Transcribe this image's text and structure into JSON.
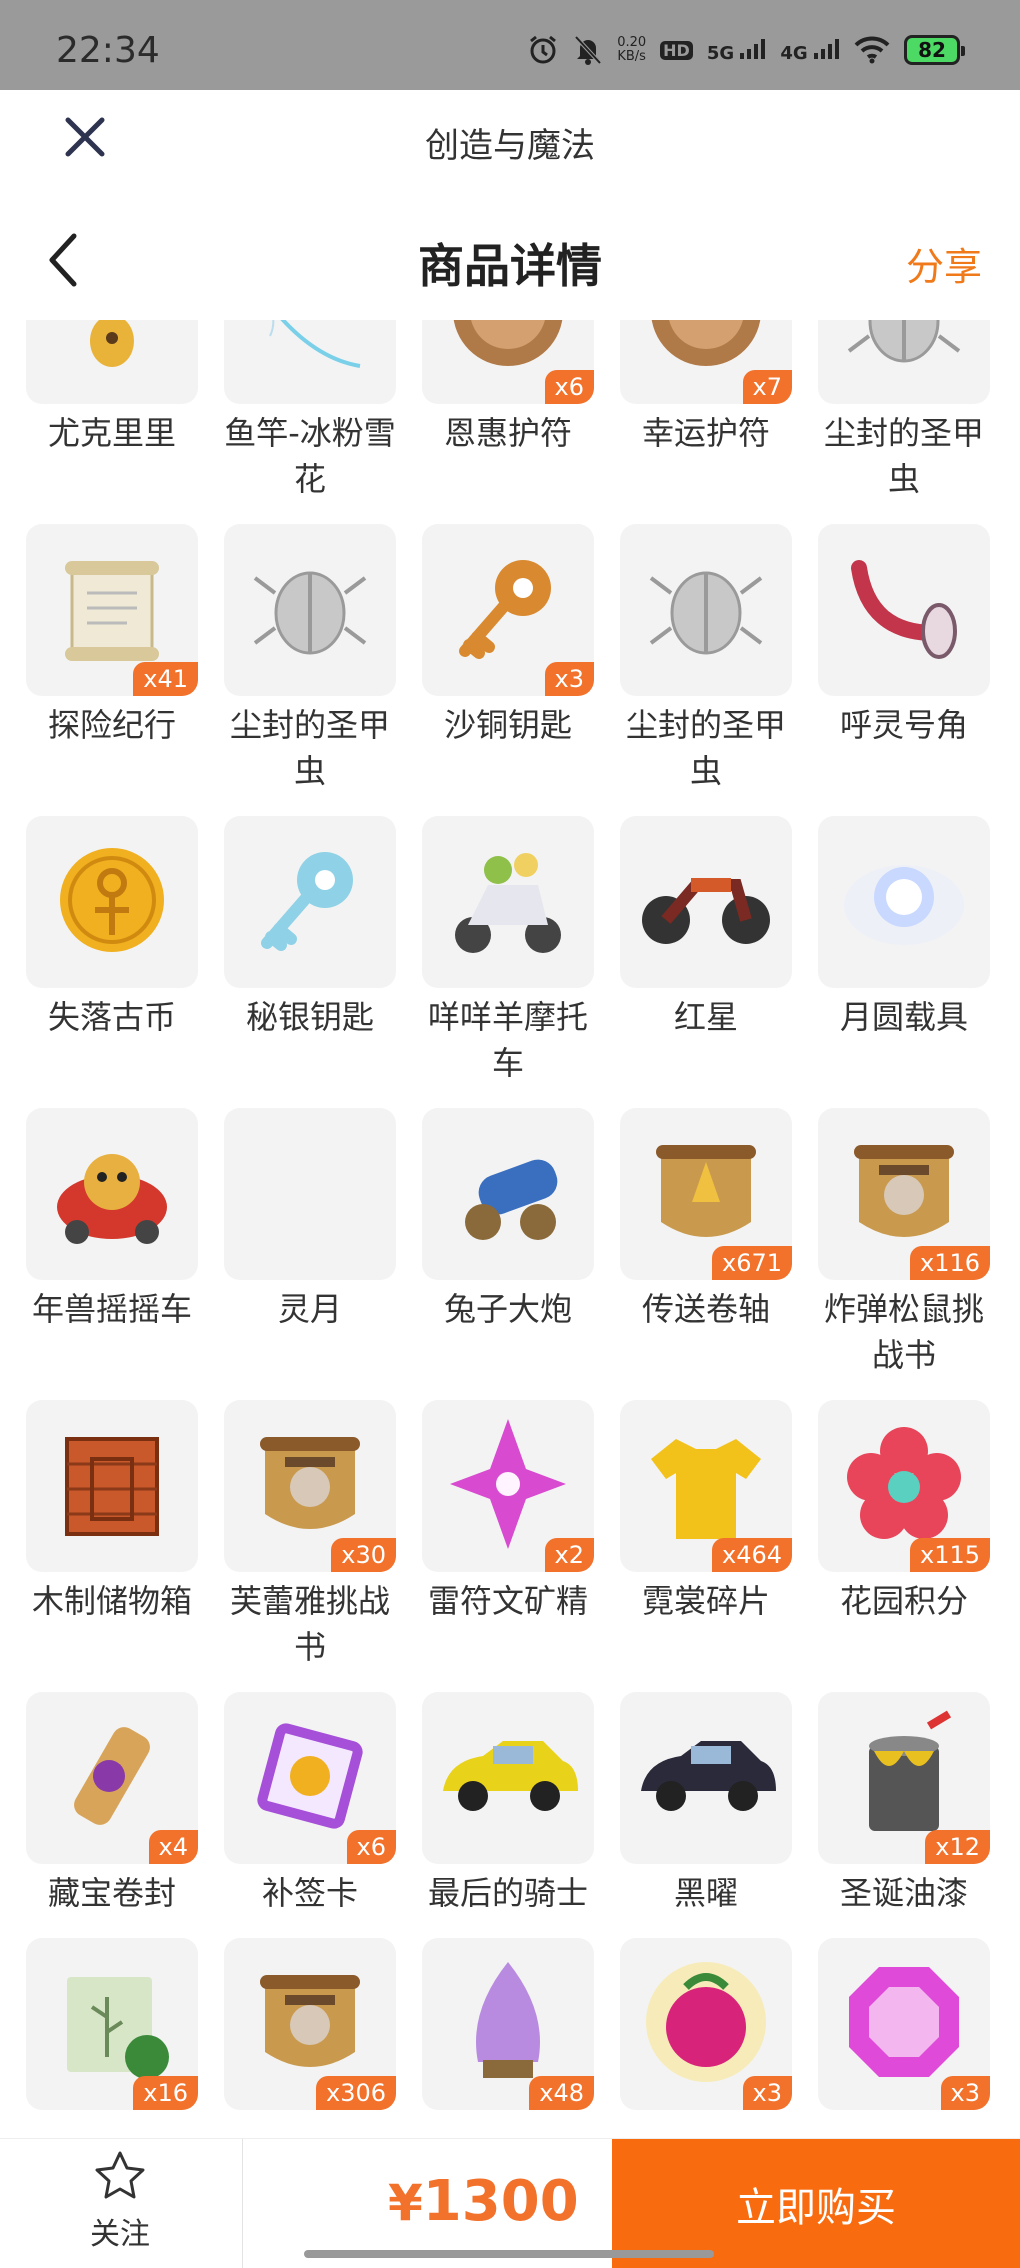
{
  "status_bar": {
    "time": "22:34",
    "speed_value": "0.20",
    "speed_unit": "KB/s",
    "hd_label": "HD",
    "net1": "5G",
    "net2": "4G",
    "battery": "82"
  },
  "app_bar": {
    "title": "创造与魔法"
  },
  "nav": {
    "title": "商品详情",
    "share": "分享"
  },
  "items": [
    {
      "name": "尤克里里",
      "qty": "",
      "icon": "ukulele",
      "color": "#e9b33a"
    },
    {
      "name": "鱼竿-冰粉雪花",
      "qty": "",
      "icon": "fishing-rod",
      "color": "#7ad0e8"
    },
    {
      "name": "恩惠护符",
      "qty": "x6",
      "icon": "amulet",
      "color": "#b07a48"
    },
    {
      "name": "幸运护符",
      "qty": "x7",
      "icon": "amulet",
      "color": "#b07a48"
    },
    {
      "name": "尘封的圣甲虫",
      "qty": "",
      "icon": "beetle",
      "color": "#9a9a9a"
    },
    {
      "name": "探险纪行",
      "qty": "x41",
      "icon": "scroll",
      "color": "#efe9d6"
    },
    {
      "name": "尘封的圣甲虫",
      "qty": "",
      "icon": "beetle",
      "color": "#9a9a9a"
    },
    {
      "name": "沙铜钥匙",
      "qty": "x3",
      "icon": "key",
      "color": "#d98a30"
    },
    {
      "name": "尘封的圣甲虫",
      "qty": "",
      "icon": "beetle",
      "color": "#9a9a9a"
    },
    {
      "name": "呼灵号角",
      "qty": "",
      "icon": "horn",
      "color": "#c2354a"
    },
    {
      "name": "失落古币",
      "qty": "",
      "icon": "coin",
      "color": "#f0b020"
    },
    {
      "name": "秘银钥匙",
      "qty": "",
      "icon": "key",
      "color": "#8fd1e6"
    },
    {
      "name": "咩咩羊摩托车",
      "qty": "",
      "icon": "scooter",
      "color": "#e6e6ee"
    },
    {
      "name": "红星",
      "qty": "",
      "icon": "motorbike",
      "color": "#7a2a22"
    },
    {
      "name": "月圆载具",
      "qty": "",
      "icon": "moon-orb",
      "color": "#c8d8ff"
    },
    {
      "name": "年兽摇摇车",
      "qty": "",
      "icon": "dragon-car",
      "color": "#d4382c"
    },
    {
      "name": "灵月",
      "qty": "",
      "icon": "crescent",
      "color": "#6a8fe0"
    },
    {
      "name": "兔子大炮",
      "qty": "",
      "icon": "cannon",
      "color": "#3a6fc0"
    },
    {
      "name": "传送卷轴",
      "qty": "x671",
      "icon": "parchment",
      "color": "#c99a4e"
    },
    {
      "name": "炸弹松鼠挑战书",
      "qty": "x116",
      "icon": "wanted",
      "color": "#c99a4e"
    },
    {
      "name": "木制储物箱",
      "qty": "",
      "icon": "crate",
      "color": "#c9582a"
    },
    {
      "name": "芙蕾雅挑战书",
      "qty": "x30",
      "icon": "wanted",
      "color": "#c99a4e"
    },
    {
      "name": "雷符文矿精",
      "qty": "x2",
      "icon": "crystal",
      "color": "#d84bd0"
    },
    {
      "name": "霓裳碎片",
      "qty": "x464",
      "icon": "shirt",
      "color": "#f3c21a"
    },
    {
      "name": "花园积分",
      "qty": "x115",
      "icon": "flower",
      "color": "#e8455a"
    },
    {
      "name": "藏宝卷封",
      "qty": "x4",
      "icon": "seal",
      "color": "#d8a45a"
    },
    {
      "name": "补签卡",
      "qty": "x6",
      "icon": "ticket",
      "color": "#a64fd8"
    },
    {
      "name": "最后的骑士",
      "qty": "",
      "icon": "car",
      "color": "#e8d21a"
    },
    {
      "name": "黑曜",
      "qty": "",
      "icon": "car",
      "color": "#2a2a3a"
    },
    {
      "name": "圣诞油漆",
      "qty": "x12",
      "icon": "paint-can",
      "color": "#555555"
    },
    {
      "name": "",
      "qty": "x16",
      "icon": "seed-bag",
      "color": "#d8e6c8"
    },
    {
      "name": "",
      "qty": "x306",
      "icon": "wanted",
      "color": "#c99a4e"
    },
    {
      "name": "",
      "qty": "x48",
      "icon": "pinecone",
      "color": "#b88be0"
    },
    {
      "name": "",
      "qty": "x3",
      "icon": "berry",
      "color": "#d8237a"
    },
    {
      "name": "",
      "qty": "x3",
      "icon": "gem",
      "color": "#e04ad8"
    }
  ],
  "bottom": {
    "follow": "关注",
    "currency": "¥",
    "price": "1300",
    "buy": "立即购买"
  },
  "colors": {
    "accent": "#f96b0f",
    "price": "#f2712b",
    "badge": "#f2712b"
  }
}
